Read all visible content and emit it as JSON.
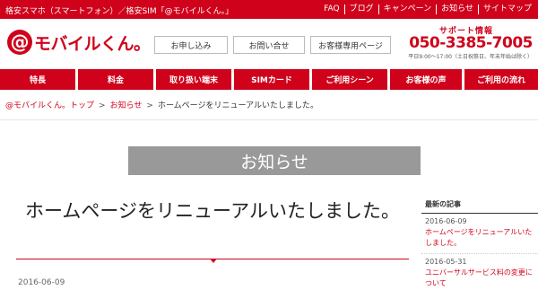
{
  "topbar": {
    "tagline": "格安スマホ（スマートフォン）／格安SIM「@モバイルくん。」",
    "links": [
      "FAQ",
      "ブログ",
      "キャンペーン",
      "お知らせ",
      "サイトマップ"
    ]
  },
  "logo": {
    "at": "@",
    "brand": "モバイルくん。"
  },
  "header_buttons": [
    "お申し込み",
    "お問い合せ",
    "お客様専用ページ"
  ],
  "support": {
    "title": "サポート情報",
    "phone": "050-3385-7005",
    "hours": "平日9:00〜17:00（土日祝祭日、年末年始は除く）"
  },
  "nav": [
    "特長",
    "料金",
    "取り扱い端末",
    "SIMカード",
    "ご利用シーン",
    "お客様の声",
    "ご利用の流れ"
  ],
  "breadcrumb": {
    "items": [
      "@モバイルくん。トップ",
      "お知らせ",
      "ホームページをリニューアルいたしました。"
    ],
    "separator": ">"
  },
  "section_heading": "お知らせ",
  "article": {
    "title": "ホームページをリニューアルいたしました。",
    "date": "2016-06-09"
  },
  "sidebar": {
    "heading": "最新の記事",
    "entries": [
      {
        "date": "2016-06-09",
        "title": "ホームページをリニューアルいたしました。"
      },
      {
        "date": "2016-05-31",
        "title": "ユニバーサルサービス料の変更について"
      }
    ]
  },
  "colors": {
    "brand_red": "#d0021b",
    "heading_gray": "#999999"
  }
}
